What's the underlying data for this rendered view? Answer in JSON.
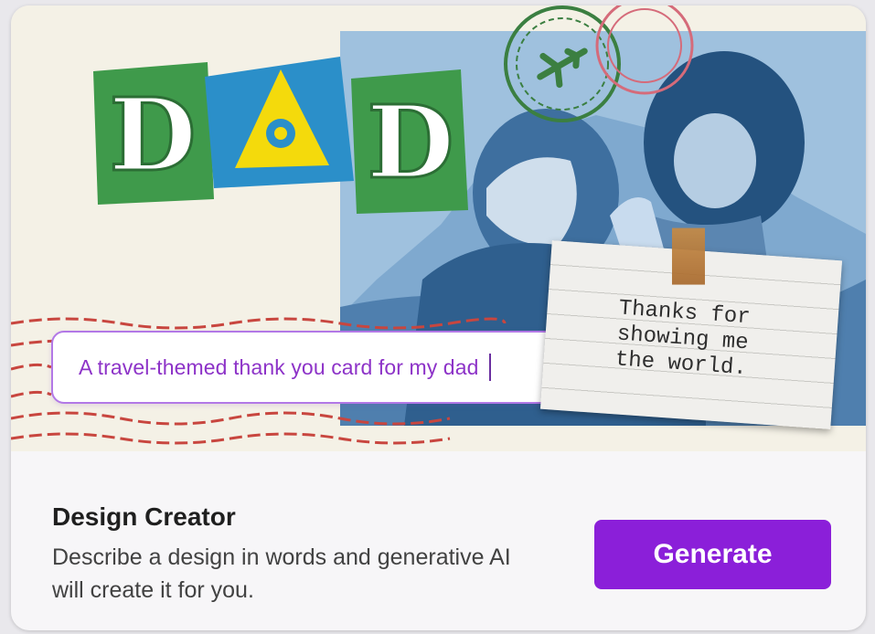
{
  "hero": {
    "title_letters": [
      "D",
      "A",
      "D"
    ],
    "prompt_text": "A travel-themed thank you card for my dad",
    "note_text": "Thanks for\nshowing me\nthe world.",
    "stamp_icon": "airplane-icon",
    "photo_subject": "father-and-daughter-photo"
  },
  "card": {
    "title": "Design Creator",
    "description": "Describe a design in words and generative AI will create it for you.",
    "button_label": "Generate"
  },
  "colors": {
    "accent": "#8b1fd9",
    "prompt_border": "#b278e6",
    "prompt_text": "#8d33c8",
    "letter_green": "#3f9a4b",
    "letter_blue": "#2b8fc9",
    "letter_yellow": "#f4da0c"
  }
}
